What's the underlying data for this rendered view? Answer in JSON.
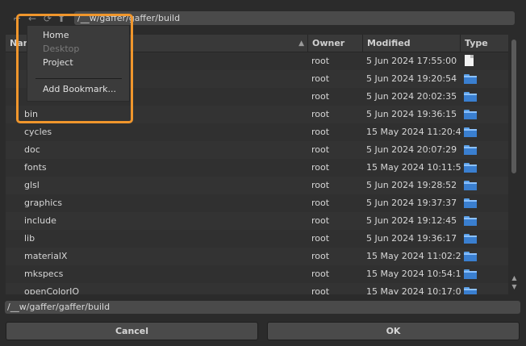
{
  "toolbar": {
    "path": "/__w/gaffer/gaffer/build"
  },
  "columns": {
    "name": "Name",
    "owner": "Owner",
    "modified": "Modified",
    "type": "Type"
  },
  "rows": [
    {
      "name": "",
      "owner": "root",
      "modified": "5 Jun 2024 17:55:00",
      "type": "file"
    },
    {
      "name": "",
      "owner": "root",
      "modified": "5 Jun 2024 19:20:54",
      "type": "folder"
    },
    {
      "name": "",
      "owner": "root",
      "modified": "5 Jun 2024 20:02:35",
      "type": "folder"
    },
    {
      "name": "bin",
      "owner": "root",
      "modified": "5 Jun 2024 19:36:15",
      "type": "folder"
    },
    {
      "name": "cycles",
      "owner": "root",
      "modified": "15 May 2024 11:20:41",
      "type": "folder"
    },
    {
      "name": "doc",
      "owner": "root",
      "modified": "5 Jun 2024 20:07:29",
      "type": "folder"
    },
    {
      "name": "fonts",
      "owner": "root",
      "modified": "15 May 2024 10:11:57",
      "type": "folder"
    },
    {
      "name": "glsl",
      "owner": "root",
      "modified": "5 Jun 2024 19:28:52",
      "type": "folder"
    },
    {
      "name": "graphics",
      "owner": "root",
      "modified": "5 Jun 2024 19:37:37",
      "type": "folder"
    },
    {
      "name": "include",
      "owner": "root",
      "modified": "5 Jun 2024 19:12:45",
      "type": "folder"
    },
    {
      "name": "lib",
      "owner": "root",
      "modified": "5 Jun 2024 19:36:17",
      "type": "folder"
    },
    {
      "name": "materialX",
      "owner": "root",
      "modified": "15 May 2024 11:02:22",
      "type": "folder"
    },
    {
      "name": "mkspecs",
      "owner": "root",
      "modified": "15 May 2024 10:54:12",
      "type": "folder"
    },
    {
      "name": "openColorIO",
      "owner": "root",
      "modified": "15 May 2024 10:17:00",
      "type": "folder"
    }
  ],
  "bookmarks_menu": {
    "items": [
      "Home",
      "Desktop",
      "Project"
    ],
    "disabled": [
      "Desktop"
    ],
    "add_bookmark": "Add Bookmark..."
  },
  "footer": {
    "path_value": "/__w/gaffer/gaffer/build",
    "cancel": "Cancel",
    "ok": "OK"
  },
  "colors": {
    "highlight": "#f0962c",
    "folder": "#3a7fd0"
  }
}
